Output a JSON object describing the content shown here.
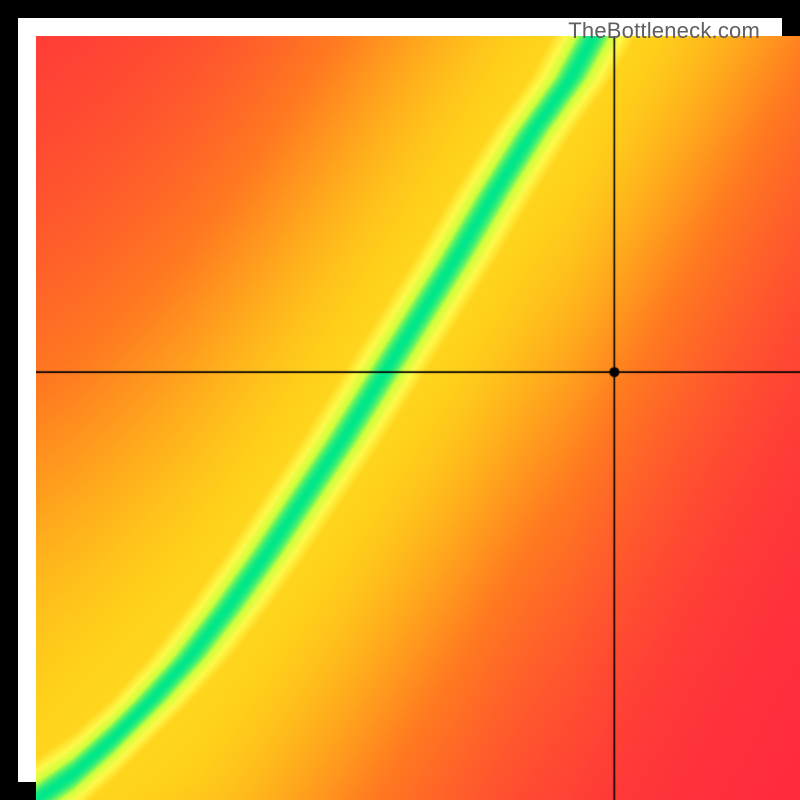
{
  "attribution": "TheBottleneck.com",
  "chart_data": {
    "type": "heatmap",
    "title": "",
    "xlabel": "",
    "ylabel": "",
    "xlim": [
      0,
      1
    ],
    "ylim": [
      0,
      1
    ],
    "colormap": {
      "description": "Red→Orange→Yellow→Green heatmap; green marks the non-bottleneck diagonal region.",
      "stops": [
        {
          "t": 0.0,
          "color": "#ff2a3e"
        },
        {
          "t": 0.35,
          "color": "#ff7a20"
        },
        {
          "t": 0.6,
          "color": "#ffd21a"
        },
        {
          "t": 0.8,
          "color": "#fff94a"
        },
        {
          "t": 0.92,
          "color": "#cfff3c"
        },
        {
          "t": 1.0,
          "color": "#00e78a"
        }
      ]
    },
    "optimal_curve": {
      "description": "Center ridge (green band) approximated by a monotone curve y = f(x) in normalized [0,1] coords (0,0 at bottom-left).",
      "points": [
        [
          0.0,
          0.0
        ],
        [
          0.05,
          0.035
        ],
        [
          0.1,
          0.08
        ],
        [
          0.15,
          0.13
        ],
        [
          0.2,
          0.185
        ],
        [
          0.25,
          0.25
        ],
        [
          0.3,
          0.32
        ],
        [
          0.35,
          0.395
        ],
        [
          0.4,
          0.47
        ],
        [
          0.45,
          0.55
        ],
        [
          0.5,
          0.63
        ],
        [
          0.55,
          0.71
        ],
        [
          0.6,
          0.795
        ],
        [
          0.65,
          0.875
        ],
        [
          0.7,
          0.945
        ],
        [
          0.73,
          1.0
        ]
      ]
    },
    "crosshair": {
      "x": 0.757,
      "y": 0.56
    },
    "marker": {
      "x": 0.757,
      "y": 0.56,
      "radius_px": 5
    },
    "grid": false,
    "legend": false
  }
}
